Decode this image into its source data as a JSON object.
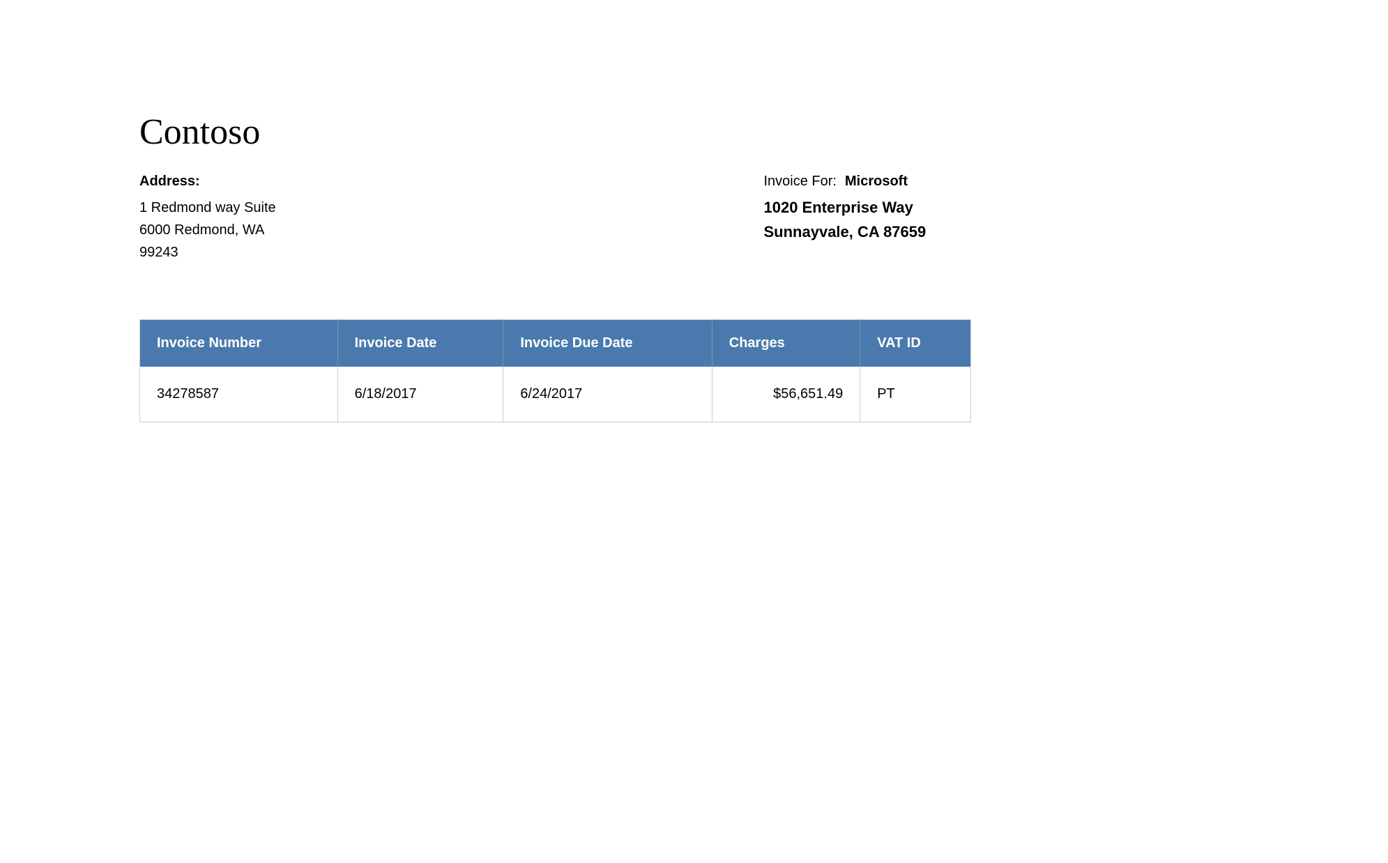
{
  "company": {
    "name": "Contoso"
  },
  "sender": {
    "address_label": "Address:",
    "address_line1": "1 Redmond way Suite",
    "address_line2": "6000 Redmond, WA",
    "address_line3": "99243"
  },
  "recipient": {
    "invoice_for_label": "Invoice For:",
    "company_name": "Microsoft",
    "address_line1": "1020 Enterprise Way",
    "address_line2": "Sunnayvale, CA 87659"
  },
  "table": {
    "headers": [
      "Invoice Number",
      "Invoice Date",
      "Invoice Due Date",
      "Charges",
      "VAT ID"
    ],
    "rows": [
      {
        "invoice_number": "34278587",
        "invoice_date": "6/18/2017",
        "invoice_due_date": "6/24/2017",
        "charges": "$56,651.49",
        "vat_id": "PT"
      }
    ]
  }
}
